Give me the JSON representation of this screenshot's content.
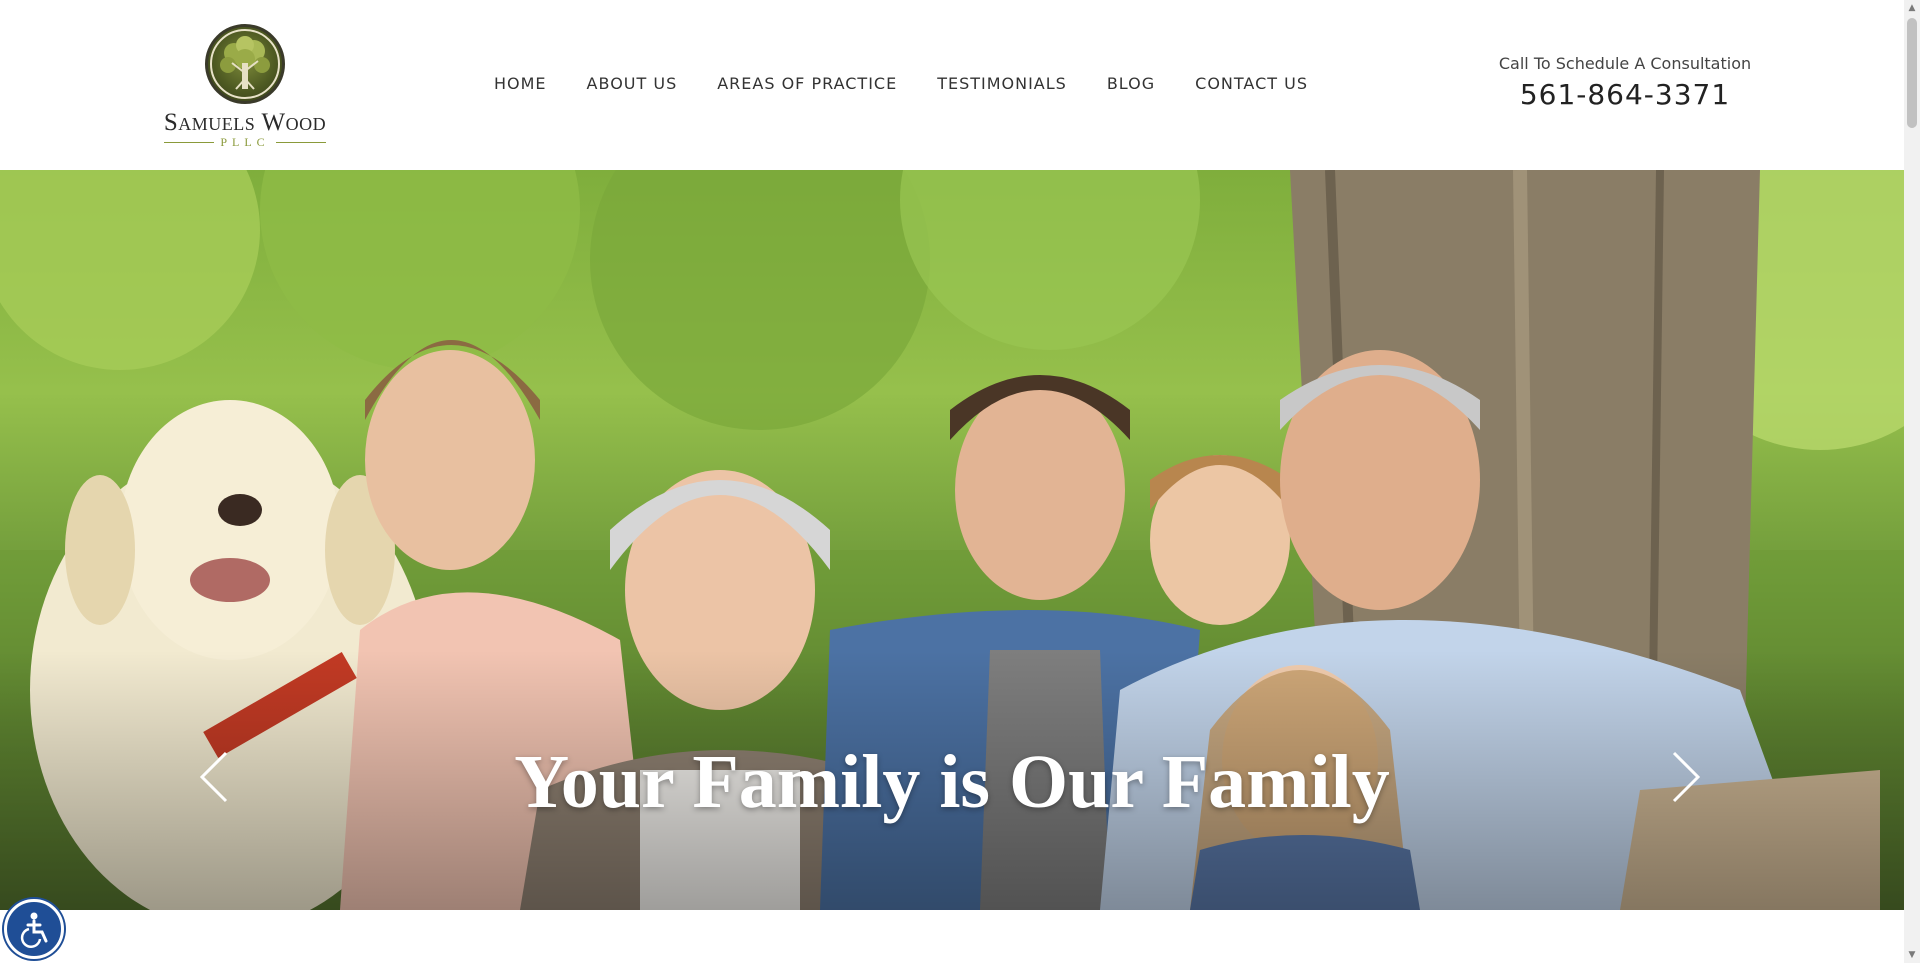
{
  "brand": {
    "name": "Samuels Wood",
    "suffix": "PLLC"
  },
  "nav": {
    "items": [
      {
        "label": "HOME"
      },
      {
        "label": "ABOUT US"
      },
      {
        "label": "AREAS OF PRACTICE"
      },
      {
        "label": "TESTIMONIALS"
      },
      {
        "label": "BLOG"
      },
      {
        "label": "CONTACT US"
      }
    ]
  },
  "contact": {
    "label": "Call To Schedule A Consultation",
    "phone": "561-864-3371"
  },
  "hero": {
    "title": "Your Family is Our Family",
    "prev_icon": "chevron-left-icon",
    "next_icon": "chevron-right-icon"
  },
  "accessibility": {
    "icon": "wheelchair-icon",
    "color": "#1f4e96"
  },
  "colors": {
    "brand_green": "#8a9a3a",
    "text_dark": "#333333"
  }
}
